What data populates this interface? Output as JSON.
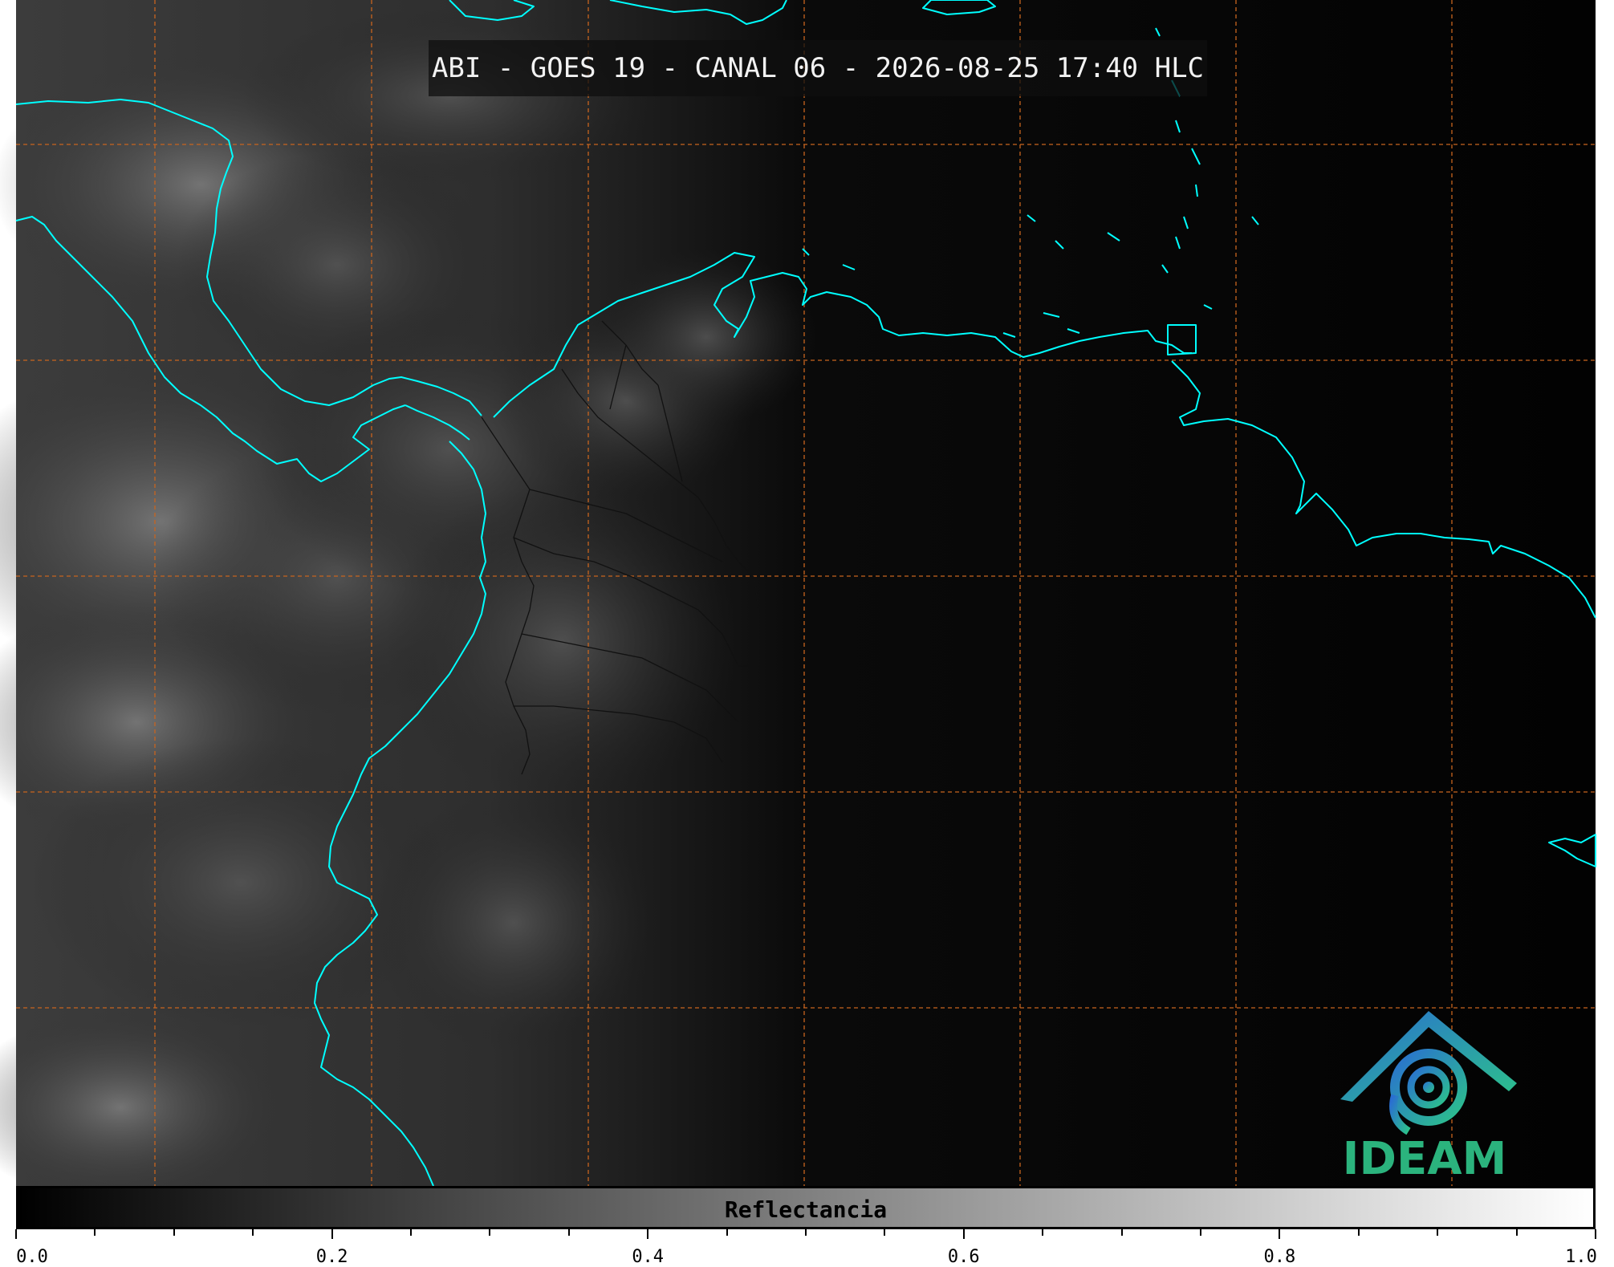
{
  "title": "ABI - GOES 19 - CANAL 06 - 2026-08-25 17:40 HLC",
  "logo": {
    "text": "IDEAM"
  },
  "colorbar": {
    "label": "Reflectancia",
    "range": [
      0.0,
      1.0
    ],
    "colors": [
      "#000000",
      "#ffffff"
    ],
    "tick_labels": [
      "0.0",
      "0.2",
      "0.4",
      "0.6",
      "0.8",
      "1.0"
    ]
  },
  "map": {
    "grid_color": "#c8641e",
    "coastline_color": "#00ffff",
    "boundary_color": "#111111",
    "background": "#030303"
  }
}
